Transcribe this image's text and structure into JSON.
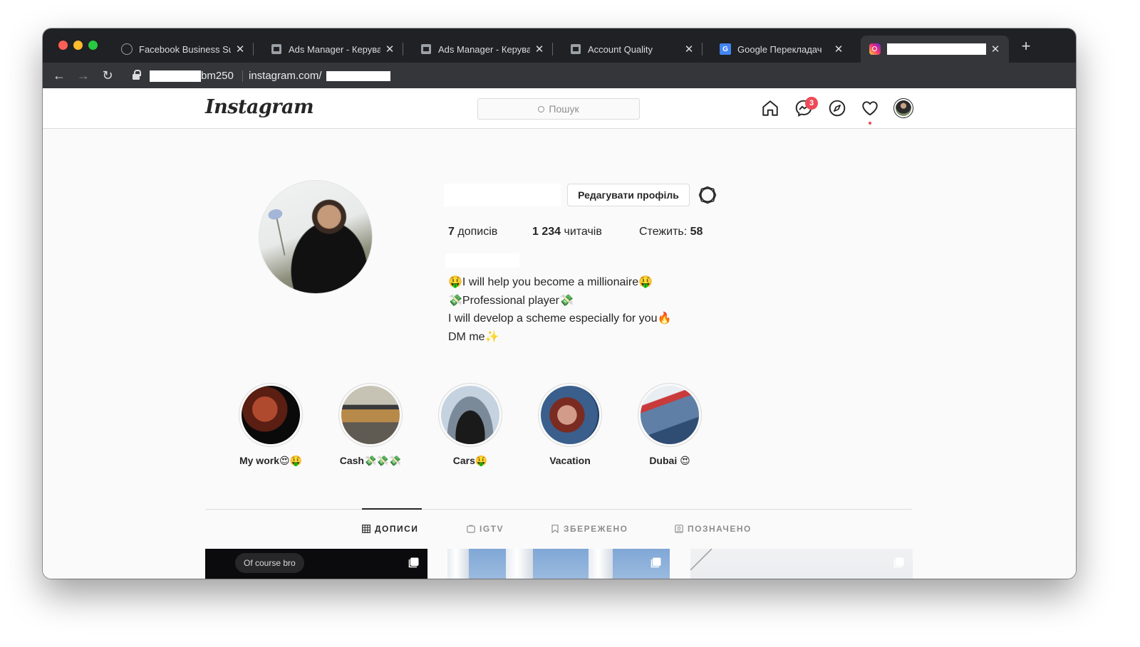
{
  "browser": {
    "tabs": [
      {
        "title": "Facebook Business Sui",
        "favicon": "facebook-business-icon"
      },
      {
        "title": "Ads Manager - Керуван",
        "favicon": "ads-manager-icon"
      },
      {
        "title": "Ads Manager - Керуван",
        "favicon": "ads-manager-icon"
      },
      {
        "title": "Account Quality",
        "favicon": "ads-manager-icon"
      },
      {
        "title": "Google Перекладач",
        "favicon": "google-translate-icon"
      },
      {
        "title": "",
        "favicon": "instagram-icon"
      }
    ],
    "new_tab_label": "+",
    "close_glyph": "✕",
    "url_prefix": "bm250",
    "url_domain": "instagram.com/"
  },
  "instagram": {
    "logo_text": "Instagram",
    "search_placeholder": "Пошук",
    "messenger_badge": "3",
    "edit_profile_label": "Редагувати профіль",
    "stats": {
      "posts_count": "7",
      "posts_label": "дописів",
      "followers_count": "1 234",
      "followers_label": "читачів",
      "following_label": "Стежить:",
      "following_count": "58"
    },
    "bio": [
      "🤑I will help you become a millionaire🤑",
      "💸Professional player💸",
      "I will develop a scheme especially for you🔥",
      "DM me✨"
    ],
    "highlights": [
      {
        "label": "My work😍🤑"
      },
      {
        "label": "Cash💸💸💸"
      },
      {
        "label": "Cars🤑"
      },
      {
        "label": "Vacation"
      },
      {
        "label": "Dubai 😍"
      }
    ],
    "profile_tabs": [
      {
        "label": "ДОПИСИ",
        "icon": "grid-icon",
        "active": true
      },
      {
        "label": "IGTV",
        "icon": "igtv-icon",
        "active": false
      },
      {
        "label": "ЗБЕРЕЖЕНО",
        "icon": "bookmark-icon",
        "active": false
      },
      {
        "label": "ПОЗНАЧЕНО",
        "icon": "tagged-icon",
        "active": false
      }
    ],
    "posts": [
      {
        "caption_chip": "Of course bro"
      }
    ]
  },
  "colors": {
    "browser_frame": "#202124",
    "browser_toolbar": "#35363a",
    "ig_text": "#262626",
    "ig_border": "#dbdbdb",
    "ig_notification": "#ed4956"
  }
}
